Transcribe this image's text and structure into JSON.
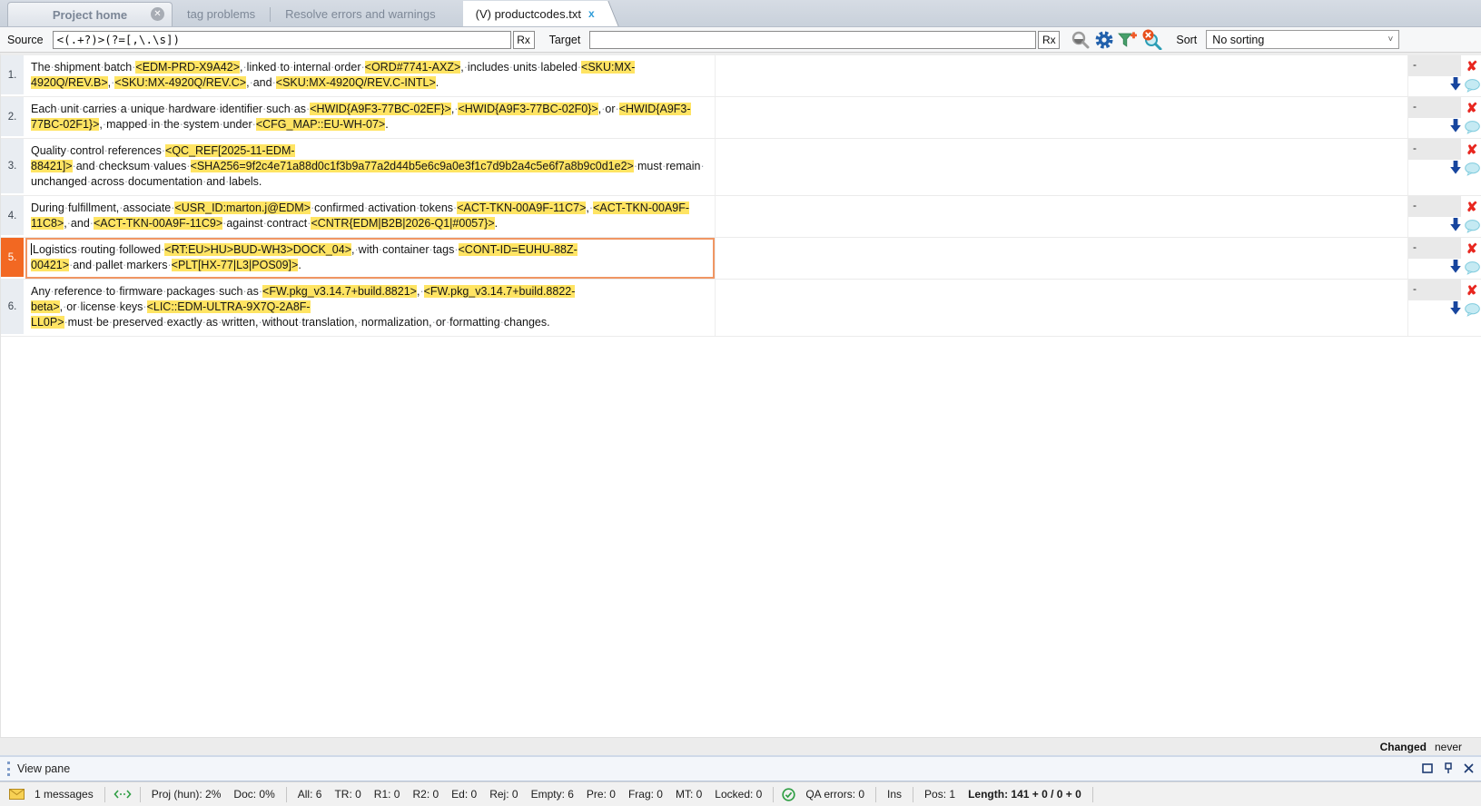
{
  "tabs": {
    "project_home": {
      "label": "Project home"
    },
    "middle": [
      {
        "label": "tag problems"
      },
      {
        "label": "Resolve errors and warnings"
      }
    ],
    "document": {
      "label": "(V) productcodes.txt",
      "close_glyph": "x"
    }
  },
  "toolbar": {
    "source_label": "Source",
    "source_value": "<(.+?)>(?=[,\\.\\s])",
    "rx_label": "Rx",
    "target_label": "Target",
    "target_value": "",
    "sort_label": "Sort",
    "sort_value": "No sorting",
    "icons": [
      "filter-lookup-icon",
      "filter-settings-gear-icon",
      "add-filter-funnel-plus-icon",
      "clear-filter-magnifier-x-icon"
    ]
  },
  "grid": {
    "rows": [
      {
        "num": "1.",
        "active": false,
        "match": "-",
        "source": [
          {
            "t": "text",
            "v": "The·shipment·batch·"
          },
          {
            "t": "tag",
            "v": "<EDM-PRD-X9A42>"
          },
          {
            "t": "text",
            "v": ",·linked·to·internal·order·"
          },
          {
            "t": "tag",
            "v": "<ORD#7741-AXZ>"
          },
          {
            "t": "text",
            "v": ",·includes·units·labeled·"
          },
          {
            "t": "tag",
            "v": "<SKU:MX-4920Q/REV.B>"
          },
          {
            "t": "text",
            "v": ",·"
          },
          {
            "t": "tag",
            "v": "<SKU:MX-4920Q/REV.C>"
          },
          {
            "t": "text",
            "v": ",·and·"
          },
          {
            "t": "tag",
            "v": "<SKU:MX-4920Q/REV.C-INTL>"
          },
          {
            "t": "text",
            "v": "."
          }
        ]
      },
      {
        "num": "2.",
        "active": false,
        "match": "-",
        "source": [
          {
            "t": "text",
            "v": "Each·unit·carries·a·unique·hardware·identifier·such·as·"
          },
          {
            "t": "tag",
            "v": "<HWID{A9F3-77BC-02EF}>"
          },
          {
            "t": "text",
            "v": ",·"
          },
          {
            "t": "tag",
            "v": "<HWID{A9F3-77BC-02F0}>"
          },
          {
            "t": "text",
            "v": ",·or·"
          },
          {
            "t": "tag",
            "v": "<HWID{A9F3-77BC-02F1}>"
          },
          {
            "t": "text",
            "v": ",·mapped·in·the·system·under·"
          },
          {
            "t": "tag",
            "v": "<CFG_MAP::EU-WH-07>"
          },
          {
            "t": "text",
            "v": "."
          }
        ]
      },
      {
        "num": "3.",
        "active": false,
        "match": "-",
        "source": [
          {
            "t": "text",
            "v": "Quality·control·references·"
          },
          {
            "t": "tag",
            "v": "<QC_REF[2025-11-EDM-88421]>"
          },
          {
            "t": "text",
            "v": "·and·checksum·values·"
          },
          {
            "t": "tag",
            "v": "<SHA256=9f2c4e71a88d0c1f3b9a77a2d44b5e6c9a0e3f1c7d9b2a4c5e6f7a8b9c0d1e2>"
          },
          {
            "t": "text",
            "v": "·must·remain·unchanged·across·documentation·and·labels."
          }
        ]
      },
      {
        "num": "4.",
        "active": false,
        "match": "-",
        "source": [
          {
            "t": "text",
            "v": "During·fulfillment,·associate·"
          },
          {
            "t": "tag",
            "v": "<USR_ID:marton.j@EDM>"
          },
          {
            "t": "text",
            "v": "·confirmed·activation·tokens·"
          },
          {
            "t": "tag",
            "v": "<ACT-TKN-00A9F-11C7>"
          },
          {
            "t": "text",
            "v": ",·"
          },
          {
            "t": "tag",
            "v": "<ACT-TKN-00A9F-11C8>"
          },
          {
            "t": "text",
            "v": ",·and·"
          },
          {
            "t": "tag",
            "v": "<ACT-TKN-00A9F-11C9>"
          },
          {
            "t": "text",
            "v": "·against·contract·"
          },
          {
            "t": "tag",
            "v": "<CNTR{EDM|B2B|2026-Q1|#0057}>"
          },
          {
            "t": "text",
            "v": "."
          }
        ]
      },
      {
        "num": "5.",
        "active": true,
        "match": "-",
        "source": [
          {
            "t": "text",
            "v": "Logistics·routing·followed·"
          },
          {
            "t": "tag",
            "v": "<RT:EU>HU>BUD-WH3>DOCK_04>"
          },
          {
            "t": "text",
            "v": ",·with·container·tags·"
          },
          {
            "t": "tag",
            "v": "<CONT-ID=EUHU-88Z-00421>"
          },
          {
            "t": "text",
            "v": "·and·pallet·markers·"
          },
          {
            "t": "tag",
            "v": "<PLT[HX-77|L3|POS09]>"
          },
          {
            "t": "text",
            "v": "."
          }
        ]
      },
      {
        "num": "6.",
        "active": false,
        "match": "-",
        "source": [
          {
            "t": "text",
            "v": "Any·reference·to·firmware·packages·such·as·"
          },
          {
            "t": "tag",
            "v": "<FW.pkg_v3.14.7+build.8821>"
          },
          {
            "t": "text",
            "v": ",·"
          },
          {
            "t": "tag",
            "v": "<FW.pkg_v3.14.7+build.8822-beta>"
          },
          {
            "t": "text",
            "v": ",·or·license·keys·"
          },
          {
            "t": "tag",
            "v": "<LIC::EDM-ULTRA-9X7Q-2A8F-LL0P>"
          },
          {
            "t": "text",
            "v": "·must·be·preserved·exactly·as·written,·without·translation,·normalization,·or·formatting·changes."
          }
        ]
      }
    ]
  },
  "footer": {
    "changed_label": "Changed",
    "changed_value": "never"
  },
  "view_pane": {
    "title": "View pane"
  },
  "status_bar": {
    "messages": "1 messages",
    "proj": "Proj (hun): 2%",
    "doc": "Doc: 0%",
    "counts": [
      "All: 6",
      "TR: 0",
      "R1: 0",
      "R2: 0",
      "Ed: 0",
      "Rej: 0",
      "Empty: 6",
      "Pre: 0",
      "Frag: 0",
      "MT: 0",
      "Locked: 0"
    ],
    "qa": "QA errors: 0",
    "ins": "Ins",
    "pos": "Pos: 1",
    "length": "Length: 141 + 0 / 0 + 0"
  },
  "colors": {
    "active_segment_orange": "#f26822",
    "selection_border": "#f09663",
    "tag_highlight": "#ffe463",
    "not_confirmed_x": "#e8261f",
    "status_arrow_blue": "#17459e",
    "comment_bubble": "#c5eaf3"
  }
}
